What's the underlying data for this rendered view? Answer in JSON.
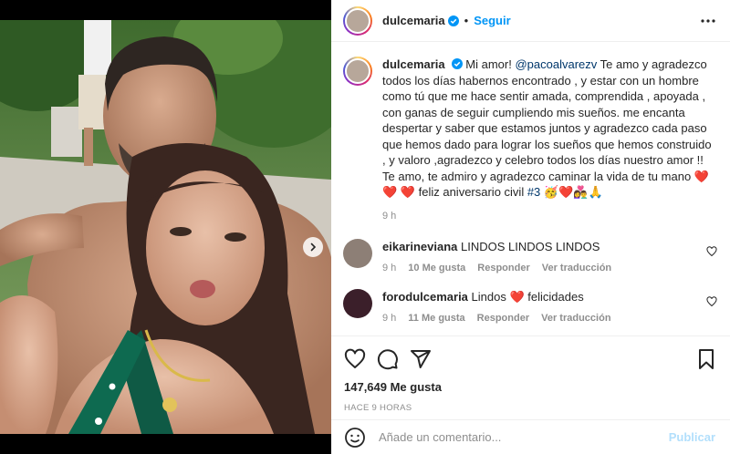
{
  "post": {
    "username": "dulcemaria",
    "separator": "•",
    "follow_label": "Seguir",
    "caption": {
      "username": "dulcemaria",
      "lead": "Mi amor! ",
      "mention": "@pacoalvarezv",
      "text": " Te amo y agradezco todos los días habernos encontrado , y estar con un hombre como tú que me hace sentir amada, comprendida , apoyada , con ganas de seguir cumpliendo mis sueños. me encanta despertar y saber que estamos juntos y agradezco cada paso que hemos dado para lograr los sueños que hemos construido , y valoro ,agradezco y celebro todos los días nuestro amor !! Te amo, te admiro y agradezco caminar la vida de tu mano ",
      "emoji_a": "❤️❤️",
      "emoji_b": "❤️",
      "text2": " feliz aniversario civil ",
      "hashtag": "#3",
      "emoji_c": " 🥳❤️👩‍❤️‍👨🙏",
      "time": "9 h"
    },
    "comments": [
      {
        "username": "eikarineviana",
        "text": "LINDOS LINDOS LINDOS",
        "emoji": "",
        "text_after": "",
        "time": "9 h",
        "likes": "10 Me gusta",
        "reply": "Responder",
        "translate": "Ver traducción"
      },
      {
        "username": "forodulcemaria",
        "text": "Lindos ",
        "emoji": "❤️",
        "text_after": " felicidades",
        "time": "9 h",
        "likes": "11 Me gusta",
        "reply": "Responder",
        "translate": "Ver traducción"
      }
    ],
    "likes_count": "147,649 Me gusta",
    "posted_ago": "HACE 9 HORAS",
    "add_comment_placeholder": "Añade un comentario...",
    "publish_label": "Publicar",
    "carousel": {
      "count": 2,
      "active": 1
    }
  },
  "icons": {
    "verified": "verified-badge-icon",
    "more": "more-options-icon",
    "like": "heart-icon",
    "comment": "comment-icon",
    "share": "share-icon",
    "save": "bookmark-icon",
    "emoji": "smiley-icon",
    "next": "chevron-right-icon"
  },
  "colors": {
    "link": "#0095f6",
    "mention": "#00376b",
    "muted": "#8e8e8e",
    "heart": "#e0245e",
    "publish": "#b2dffc",
    "active_dot": "#3897f0"
  }
}
